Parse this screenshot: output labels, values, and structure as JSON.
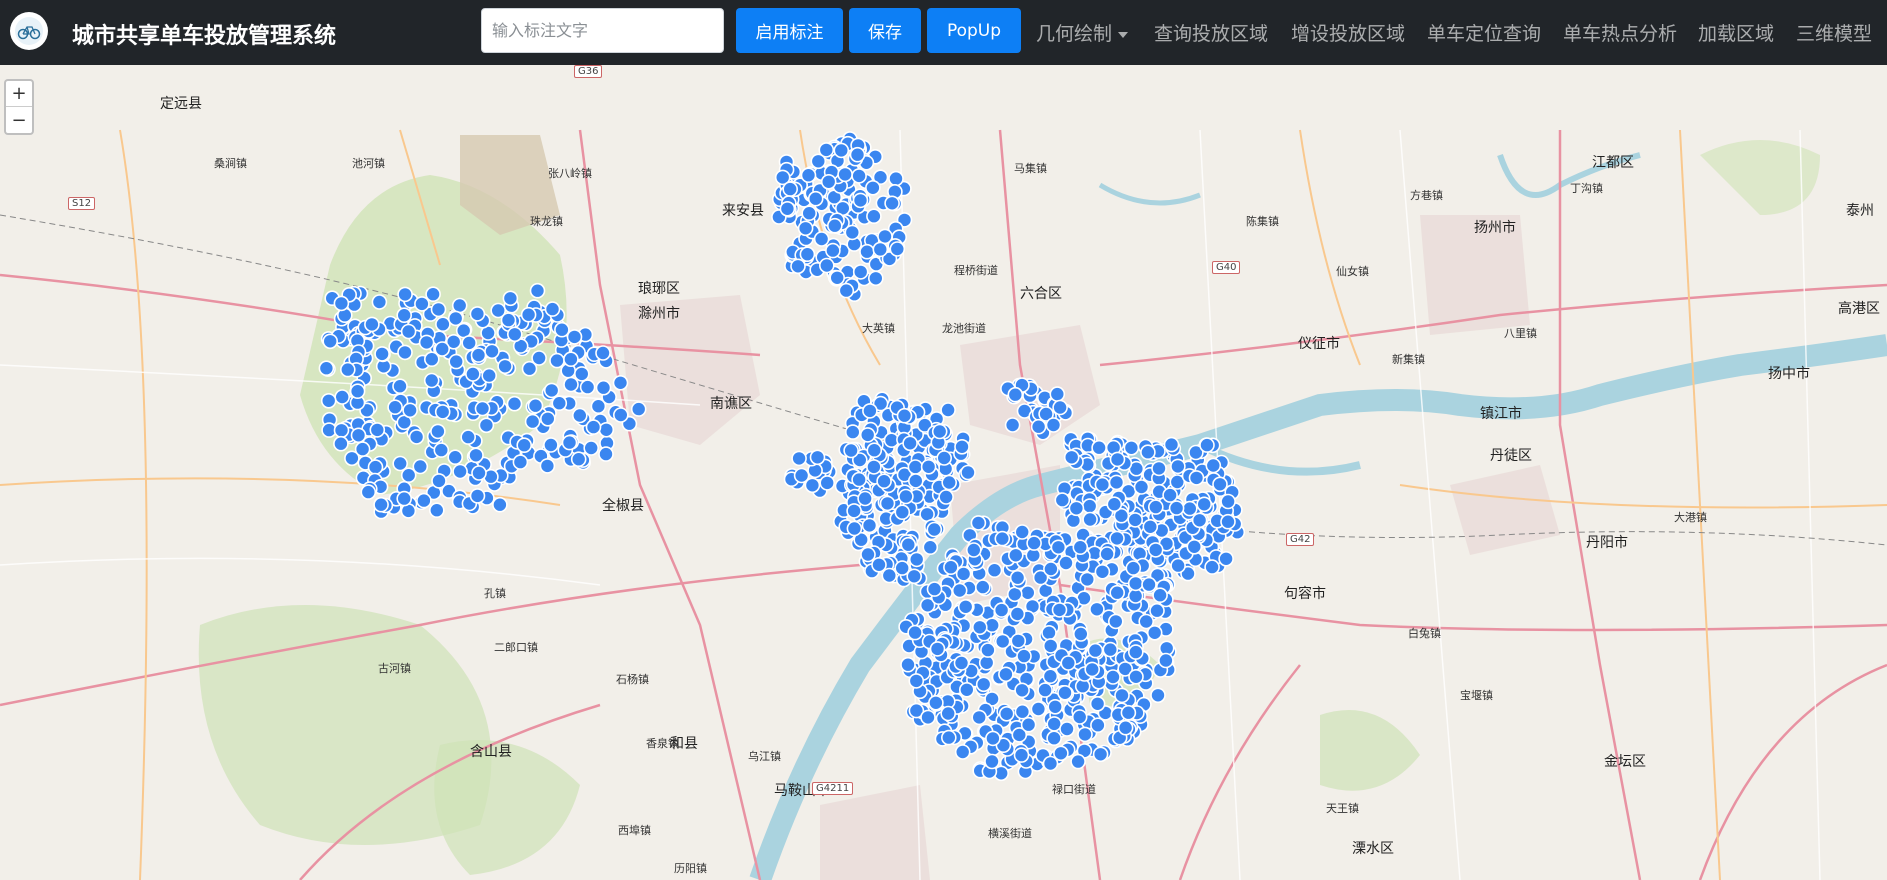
{
  "app": {
    "title": "城市共享单车投放管理系统"
  },
  "toolbar": {
    "annotation_input_placeholder": "输入标注文字",
    "enable_annotation_label": "启用标注",
    "save_label": "保存",
    "popup_label": "PopUp"
  },
  "nav": {
    "items": [
      {
        "label": "几何绘制"
      },
      {
        "label": "查询投放区域"
      },
      {
        "label": "增设投放区域"
      },
      {
        "label": "单车定位查询"
      },
      {
        "label": "单车热点分析"
      },
      {
        "label": "加载区域"
      },
      {
        "label": "三维模型"
      }
    ]
  },
  "map": {
    "zoom_in": "+",
    "zoom_out": "−",
    "marker_color": "#3a86f0",
    "places": [
      "定远县",
      "来安县",
      "滁州市",
      "琅琊区",
      "南谯区",
      "全椒县",
      "六合区",
      "仪征市",
      "扬州市",
      "江都区",
      "镇江市",
      "丹徒区",
      "丹阳市",
      "句容市",
      "扬中市",
      "高港区",
      "泰州",
      "和县",
      "含山县",
      "马鞍山市",
      "金坛区",
      "溧水区",
      "桑涧镇",
      "池河镇",
      "张八岭镇",
      "珠龙镇",
      "大英镇",
      "马集镇",
      "龙池街道",
      "程桥街道",
      "新集镇",
      "陈集镇",
      "方巷镇",
      "八里镇",
      "大港镇",
      "丁沟镇",
      "仙女镇",
      "宝堰镇",
      "白兔镇",
      "天王镇",
      "孔镇",
      "二郎口镇",
      "石杨镇",
      "香泉镇",
      "乌江镇",
      "西埠镇",
      "历阳镇",
      "横溪街道",
      "禄口街道",
      "古河镇"
    ],
    "shields": [
      "G36",
      "S12",
      "G40",
      "G42",
      "G4211"
    ]
  }
}
